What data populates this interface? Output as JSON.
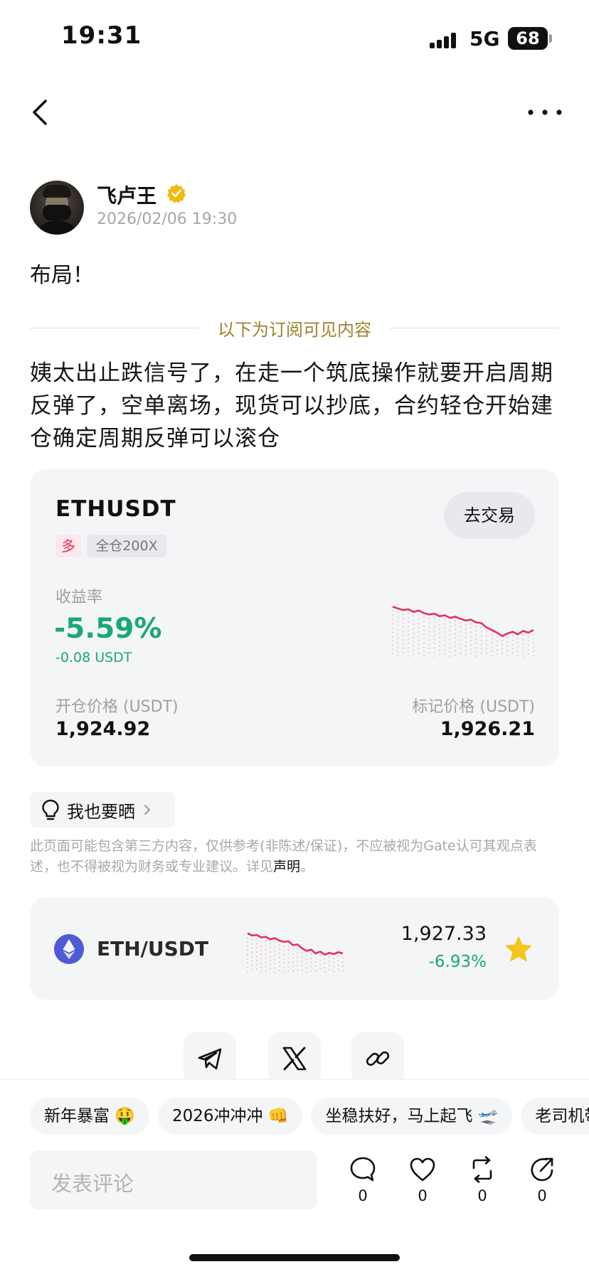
{
  "status_bar": {
    "time": "19:31",
    "network": "5G",
    "battery": "68"
  },
  "nav": {
    "back_icon": "chevron-left-icon",
    "more_icon": "ellipsis-icon"
  },
  "author": {
    "name": "飞卢王",
    "date": "2026/02/06 19:30",
    "verified_color": "#f0b90b"
  },
  "post": {
    "short_text": "布局！",
    "divider_label": "以下为订阅可见内容",
    "body_text": "姨太出止跌信号了，在走一个筑底操作就要开启周期反弹了，空单离场，现货可以抄底，合约轻仓开始建仓确定周期反弹可以滚仓"
  },
  "position": {
    "symbol": "ETHUSDT",
    "trade_button": "去交易",
    "side_tag": "多",
    "leverage_tag": "全仓200X",
    "pnl_label": "收益率",
    "pnl_pct": "-5.59%",
    "pnl_amount": "-0.08 USDT",
    "open_price_label": "开仓价格 (USDT)",
    "open_price": "1,924.92",
    "mark_price_label": "标记价格 (USDT)",
    "mark_price": "1,926.21",
    "sparkline": [
      0.78,
      0.74,
      0.7,
      0.72,
      0.66,
      0.69,
      0.63,
      0.6,
      0.62,
      0.56,
      0.58,
      0.52,
      0.55,
      0.5,
      0.46,
      0.48,
      0.42,
      0.4,
      0.3,
      0.24,
      0.18,
      0.1,
      0.16,
      0.2,
      0.14,
      0.22,
      0.18,
      0.24
    ]
  },
  "share_chip": {
    "label": "我也要晒"
  },
  "disclaimer": {
    "text": "此页面可能包含第三方内容，仅供参考(非陈述/保证)，不应被视为Gate认可其观点表述，也不得被视为财务或专业建议。详见",
    "link": "声明",
    "suffix": "。"
  },
  "market": {
    "pair": "ETH/USDT",
    "price": "1,927.33",
    "change": "-6.93%",
    "sparkline": [
      0.85,
      0.78,
      0.8,
      0.72,
      0.74,
      0.66,
      0.7,
      0.62,
      0.58,
      0.6,
      0.48,
      0.5,
      0.38,
      0.3,
      0.34,
      0.22,
      0.28,
      0.18,
      0.24,
      0.2,
      0.26,
      0.22
    ]
  },
  "colors": {
    "down": "#e4305a",
    "profit_negative_display": "#1aa77a",
    "star": "#f5c518"
  },
  "share_buttons": [
    "telegram-icon",
    "x-icon",
    "link-icon"
  ],
  "chips": [
    "新年暴富 🤑",
    "2026冲冲冲 👊",
    "坐稳扶好，马上起飞 🛫",
    "老司机带带我"
  ],
  "comment": {
    "placeholder": "发表评论"
  },
  "actions": [
    {
      "icon": "comment-icon",
      "count": "0"
    },
    {
      "icon": "heart-icon",
      "count": "0"
    },
    {
      "icon": "repost-icon",
      "count": "0"
    },
    {
      "icon": "share-icon",
      "count": "0"
    }
  ]
}
